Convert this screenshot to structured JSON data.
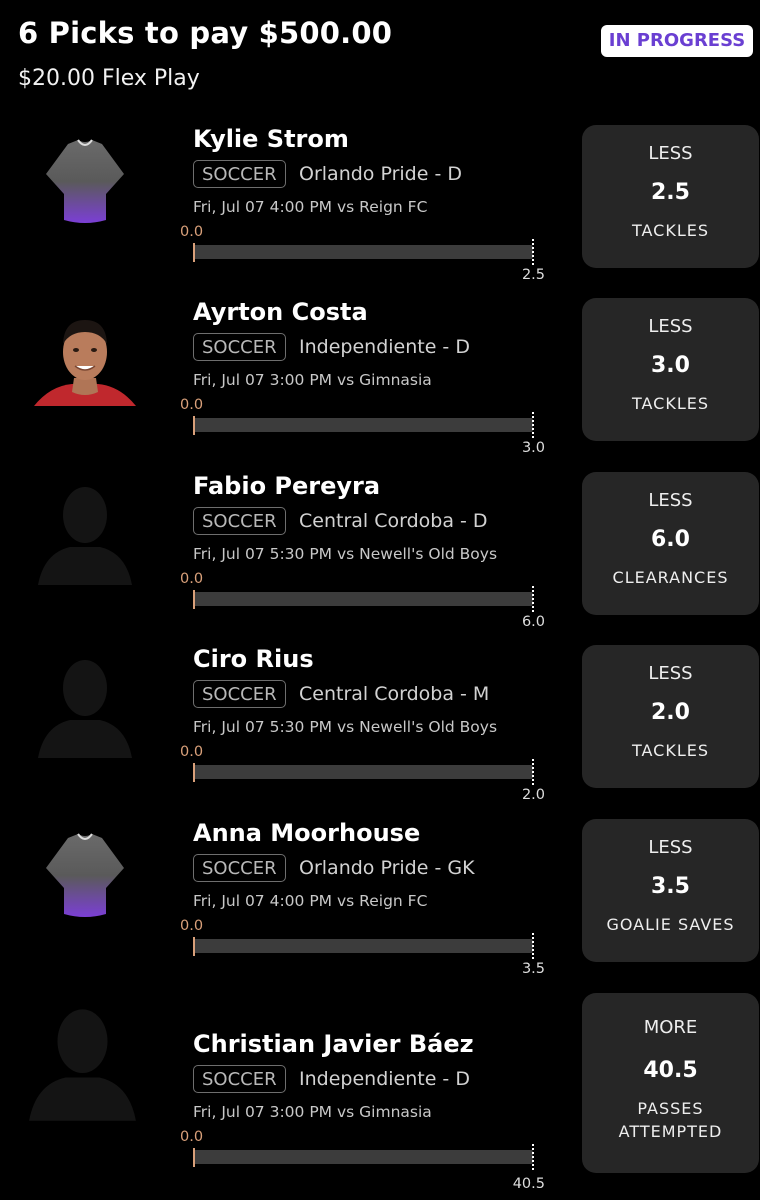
{
  "header": {
    "title": "6 Picks to pay $500.00",
    "subtitle": "$20.00 Flex Play",
    "status": "IN PROGRESS"
  },
  "colors": {
    "status_text": "#6a3fd2",
    "card_bg": "#262626",
    "current_marker": "#d9a07a"
  },
  "picks": [
    {
      "name": "Kylie Strom",
      "sport": "SOCCER",
      "team": "Orlando Pride - D",
      "game": "Fri, Jul 07 4:00 PM  vs Reign FC",
      "current": "0.0",
      "target": "2.5",
      "direction": "LESS",
      "line": "2.5",
      "stat": "TACKLES",
      "avatar": "jersey-icon"
    },
    {
      "name": "Ayrton Costa",
      "sport": "SOCCER",
      "team": "Independiente - D",
      "game": "Fri, Jul 07 3:00 PM  vs Gimnasia",
      "current": "0.0",
      "target": "3.0",
      "direction": "LESS",
      "line": "3.0",
      "stat": "TACKLES",
      "avatar": "player-photo"
    },
    {
      "name": "Fabio Pereyra",
      "sport": "SOCCER",
      "team": "Central Cordoba - D",
      "game": "Fri, Jul 07 5:30 PM  vs Newell's Old Boys",
      "current": "0.0",
      "target": "6.0",
      "direction": "LESS",
      "line": "6.0",
      "stat": "CLEARANCES",
      "avatar": "silhouette-icon"
    },
    {
      "name": "Ciro Rius",
      "sport": "SOCCER",
      "team": "Central Cordoba - M",
      "game": "Fri, Jul 07 5:30 PM  vs Newell's Old Boys",
      "current": "0.0",
      "target": "2.0",
      "direction": "LESS",
      "line": "2.0",
      "stat": "TACKLES",
      "avatar": "silhouette-icon"
    },
    {
      "name": "Anna Moorhouse",
      "sport": "SOCCER",
      "team": "Orlando Pride - GK",
      "game": "Fri, Jul 07 4:00 PM  vs Reign FC",
      "current": "0.0",
      "target": "3.5",
      "direction": "LESS",
      "line": "3.5",
      "stat": "GOALIE SAVES",
      "avatar": "jersey-icon"
    },
    {
      "name": "Christian Javier Báez",
      "sport": "SOCCER",
      "team": "Independiente - D",
      "game": "Fri, Jul 07 3:00 PM  vs Gimnasia",
      "current": "0.0",
      "target": "40.5",
      "direction": "MORE",
      "line": "40.5",
      "stat": "PASSES ATTEMPTED",
      "avatar": "silhouette-icon"
    }
  ]
}
